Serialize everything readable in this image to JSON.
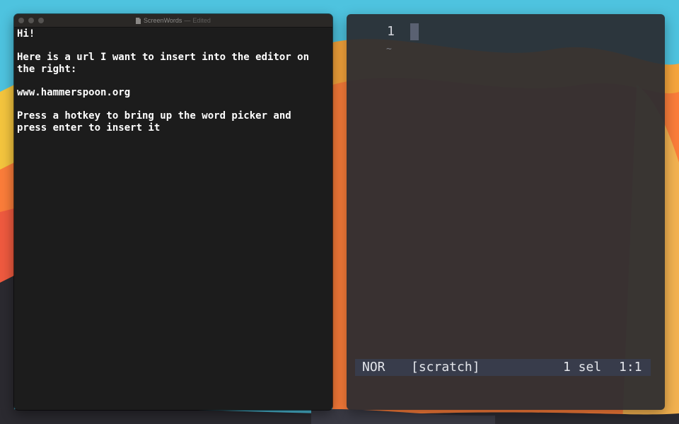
{
  "desktop": {
    "colors": {
      "sky": "#4ec3df",
      "orange": "#fb7d3a",
      "yellow": "#f4c53e",
      "red": "#ef5a3f",
      "dark": "#2b2a30"
    }
  },
  "textedit": {
    "title": "ScreenWords",
    "title_separator": "—",
    "status": "Edited",
    "icon": "document-icon",
    "lines": [
      "Hi!",
      "",
      "Here is a url I want to insert into the editor on",
      "the right:",
      "",
      "www.hammerspoon.org",
      "",
      "Press a hotkey to bring up the word picker and",
      "press enter to insert it"
    ]
  },
  "editor": {
    "line_number": "1",
    "tilde": "~",
    "status": {
      "mode": "NOR",
      "buffer": "[scratch]",
      "selections": "1 sel",
      "position": "1:1"
    },
    "colors": {
      "background": "#2a2b30",
      "cursor": "#5a6172",
      "statusline": "#383c4b"
    }
  }
}
